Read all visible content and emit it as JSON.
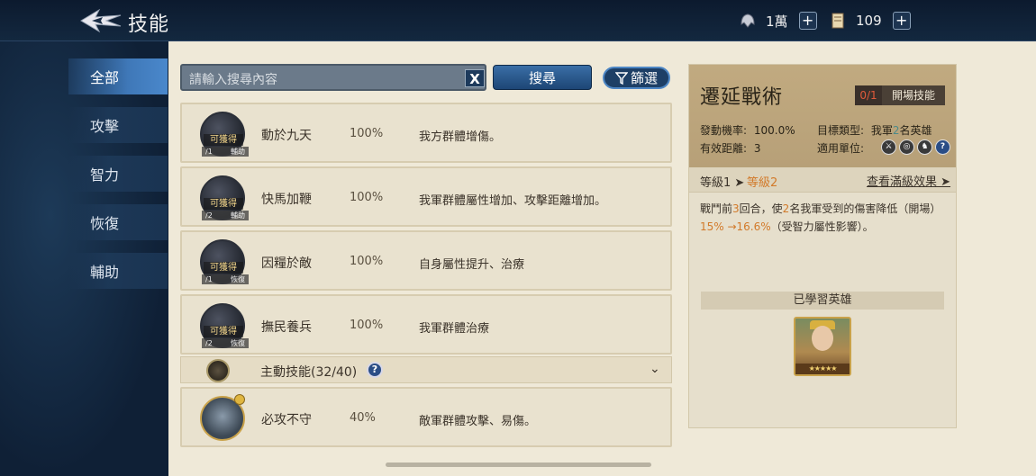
{
  "header": {
    "title": "技能",
    "resource1_value": "1萬",
    "resource2_value": "109",
    "plus_label": "+"
  },
  "nav": {
    "items": [
      {
        "label": "全部"
      },
      {
        "label": "攻擊"
      },
      {
        "label": "智力"
      },
      {
        "label": "恢復"
      },
      {
        "label": "輔助"
      }
    ]
  },
  "search": {
    "placeholder": "請輸入搜尋內容",
    "clear_label": "X",
    "search_label": "搜尋",
    "filter_label": "篩選"
  },
  "skills": [
    {
      "name": "動於九天",
      "rate": "100%",
      "desc": "我方群體增傷。",
      "tag": "可獲得",
      "count": "/1",
      "kind": "輔助"
    },
    {
      "name": "快馬加鞭",
      "rate": "100%",
      "desc": "我軍群體屬性增加、攻擊距離增加。",
      "tag": "可獲得",
      "count": "/2",
      "kind": "輔助"
    },
    {
      "name": "因糧於敵",
      "rate": "100%",
      "desc": "自身屬性提升、治療",
      "tag": "可獲得",
      "count": "/1",
      "kind": "恢復"
    },
    {
      "name": "撫民養兵",
      "rate": "100%",
      "desc": "我軍群體治療",
      "tag": "可獲得",
      "count": "/2",
      "kind": "恢復"
    }
  ],
  "section": {
    "title": "主動技能(32/40)",
    "help": "?",
    "chevron": "⌄"
  },
  "skill5": {
    "name": "必攻不守",
    "rate": "40%",
    "desc": "敵軍群體攻擊、易傷。"
  },
  "detail": {
    "title": "遷延戰術",
    "count": "0/1",
    "type": "開場技能",
    "trigger_label": "發動機率:",
    "trigger_value": "100.0%",
    "target_label": "目標類型:",
    "target_pre": "我軍",
    "target_num": "2",
    "target_post": "名英雄",
    "range_label": "有效距離:",
    "range_value": "3",
    "unit_label": "適用單位:",
    "level1": "等級1 ➤",
    "level2": "等級2",
    "full_link": "查看滿級效果 ➤",
    "effect_a": "戰鬥前",
    "effect_b": "3",
    "effect_c": "回合，使",
    "effect_d": "2",
    "effect_e": "名我軍受到的傷害降低（開場）",
    "effect_f": "15% →16.6%",
    "effect_g": "（受智力屬性影響）。",
    "learned_title": "已學習英雄",
    "hero_stars": "★★★★★"
  }
}
